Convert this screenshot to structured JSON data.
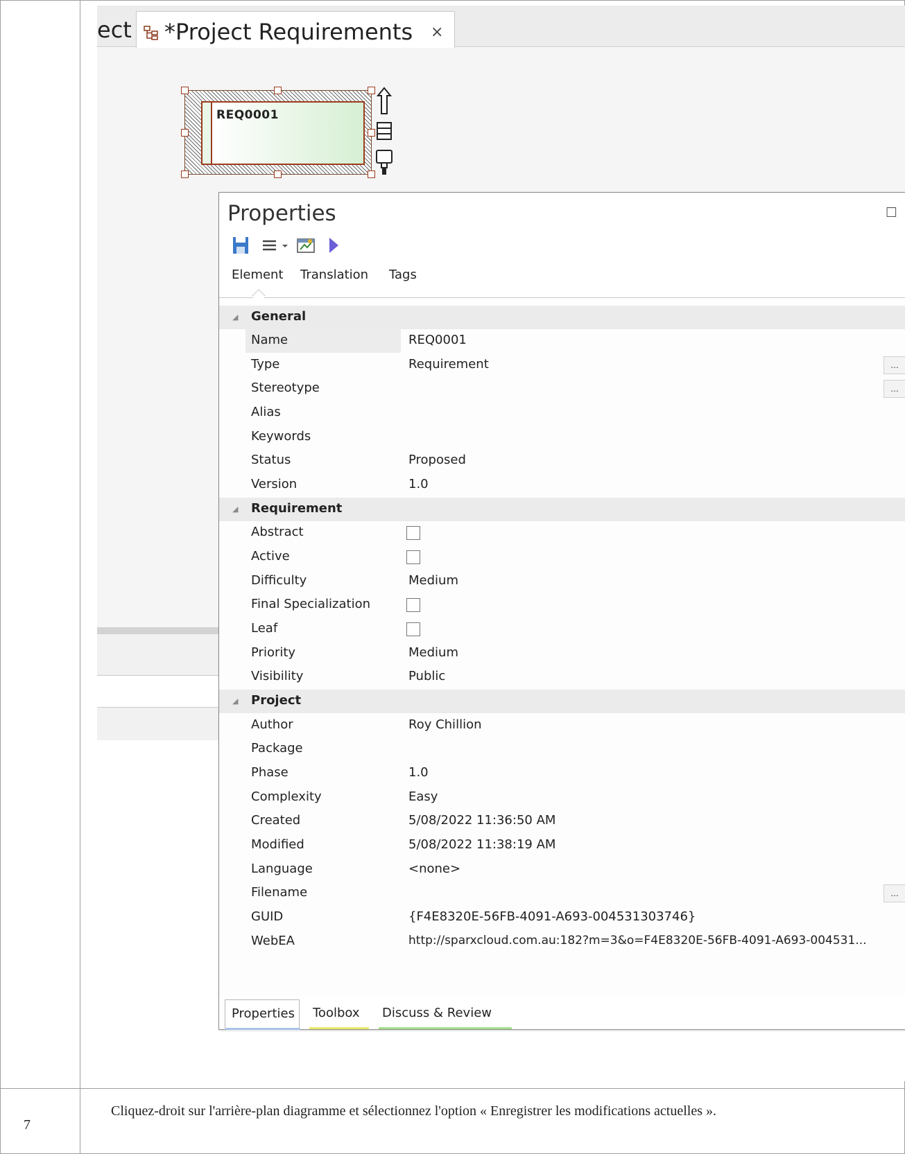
{
  "document": {
    "step_number": "7",
    "step_text": "Cliquez-droit sur l'arrière-plan diagramme et sélectionnez l'option « Enregistrer les modifications actuelles »."
  },
  "diagram_tabs": {
    "previous_tab_fragment": "ect",
    "active_tab_title": "*Project Requirements",
    "close_glyph": "×"
  },
  "diagram_element": {
    "name": "REQ0001"
  },
  "properties_window": {
    "title": "Properties",
    "maximize_glyph": "☐",
    "close_glyph": "×",
    "subtabs": [
      "Element",
      "Translation",
      "Tags"
    ],
    "ellipsis": "...",
    "sections": {
      "general": {
        "label": "General",
        "rows": {
          "name": {
            "label": "Name",
            "value": "REQ0001"
          },
          "type": {
            "label": "Type",
            "value": "Requirement"
          },
          "stereotype": {
            "label": "Stereotype",
            "value": ""
          },
          "alias": {
            "label": "Alias",
            "value": ""
          },
          "keywords": {
            "label": "Keywords",
            "value": ""
          },
          "status": {
            "label": "Status",
            "value": "Proposed"
          },
          "version": {
            "label": "Version",
            "value": "1.0"
          }
        }
      },
      "requirement": {
        "label": "Requirement",
        "rows": {
          "abstract": {
            "label": "Abstract",
            "checked": false
          },
          "active": {
            "label": "Active",
            "checked": false
          },
          "difficulty": {
            "label": "Difficulty",
            "value": "Medium"
          },
          "final_specialization": {
            "label": "Final Specialization",
            "checked": false
          },
          "leaf": {
            "label": "Leaf",
            "checked": false
          },
          "priority": {
            "label": "Priority",
            "value": "Medium"
          },
          "visibility": {
            "label": "Visibility",
            "value": "Public"
          }
        }
      },
      "project": {
        "label": "Project",
        "rows": {
          "author": {
            "label": "Author",
            "value": "Roy Chillion"
          },
          "package": {
            "label": "Package",
            "value": ""
          },
          "phase": {
            "label": "Phase",
            "value": "1.0"
          },
          "complexity": {
            "label": "Complexity",
            "value": "Easy"
          },
          "created": {
            "label": "Created",
            "value": "5/08/2022 11:36:50 AM"
          },
          "modified": {
            "label": "Modified",
            "value": "5/08/2022 11:38:19 AM"
          },
          "language": {
            "label": "Language",
            "value": "<none>"
          },
          "filename": {
            "label": "Filename",
            "value": ""
          },
          "guid": {
            "label": "GUID",
            "value": "{F4E8320E-56FB-4091-A693-004531303746}"
          },
          "webea": {
            "label": "WebEA",
            "value": "http://sparxcloud.com.au:182?m=3&o=F4E8320E-56FB-4091-A693-004531..."
          }
        }
      }
    },
    "bottom_tabs": [
      {
        "label": "Properties",
        "underline_color": "#a9c4e8"
      },
      {
        "label": "Toolbox",
        "underline_color": "#e9e96a"
      },
      {
        "label": "Discuss & Review",
        "underline_color": "#a6df8e"
      }
    ]
  },
  "colors": {
    "element_border": "#9b3b1c",
    "element_fill_end": "#d6efd3",
    "save_icon": "#3b79c9",
    "run_icon": "#6a5fd6"
  }
}
